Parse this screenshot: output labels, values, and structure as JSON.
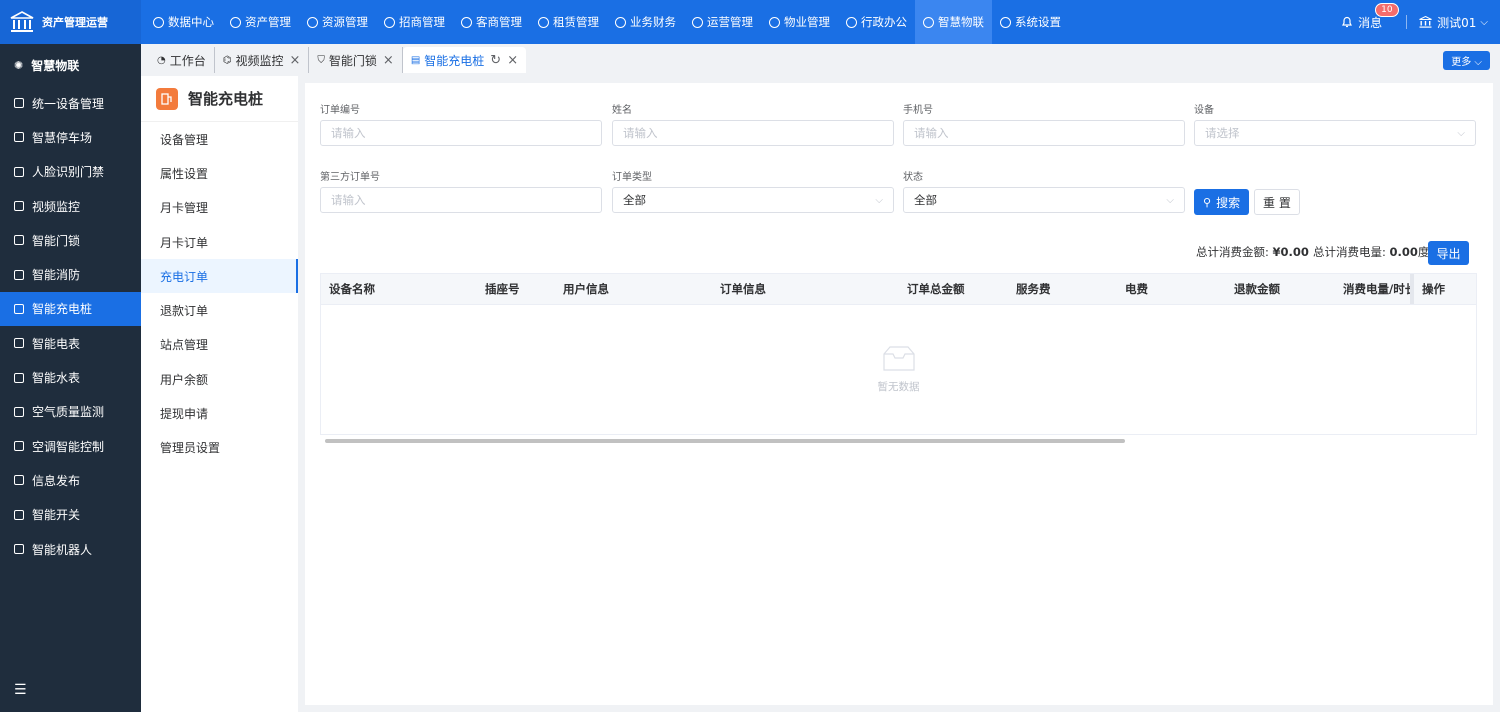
{
  "app": {
    "title": "资产管理运营"
  },
  "topnav": [
    {
      "label": "数据中心",
      "icon": "clock-icon"
    },
    {
      "label": "资产管理",
      "icon": "cube-icon"
    },
    {
      "label": "资源管理",
      "icon": "building-icon"
    },
    {
      "label": "招商管理",
      "icon": "tag-icon"
    },
    {
      "label": "客商管理",
      "icon": "users-icon"
    },
    {
      "label": "租赁管理",
      "icon": "house-icon"
    },
    {
      "label": "业务财务",
      "icon": "coin-icon"
    },
    {
      "label": "运营管理",
      "icon": "chart-icon"
    },
    {
      "label": "物业管理",
      "icon": "home-icon"
    },
    {
      "label": "行政办公",
      "icon": "monitor-icon"
    },
    {
      "label": "智慧物联",
      "icon": "atom-icon"
    },
    {
      "label": "系统设置",
      "icon": "gear-icon"
    }
  ],
  "header": {
    "messages_label": "消息",
    "messages_count": "10",
    "user_label": "测试01"
  },
  "sidebar": {
    "title": "智慧物联",
    "items": [
      {
        "label": "统一设备管理"
      },
      {
        "label": "智慧停车场"
      },
      {
        "label": "人脸识别门禁"
      },
      {
        "label": "视频监控"
      },
      {
        "label": "智能门锁"
      },
      {
        "label": "智能消防"
      },
      {
        "label": "智能充电桩"
      },
      {
        "label": "智能电表"
      },
      {
        "label": "智能水表"
      },
      {
        "label": "空气质量监测"
      },
      {
        "label": "空调智能控制"
      },
      {
        "label": "信息发布"
      },
      {
        "label": "智能开关"
      },
      {
        "label": "智能机器人"
      }
    ]
  },
  "tabs": [
    {
      "label": "工作台"
    },
    {
      "label": "视频监控"
    },
    {
      "label": "智能门锁"
    },
    {
      "label": "智能充电桩"
    }
  ],
  "more_label": "更多",
  "submenu": {
    "title": "智能充电桩",
    "items": [
      {
        "label": "设备管理"
      },
      {
        "label": "属性设置"
      },
      {
        "label": "月卡管理"
      },
      {
        "label": "月卡订单"
      },
      {
        "label": "充电订单"
      },
      {
        "label": "退款订单"
      },
      {
        "label": "站点管理"
      },
      {
        "label": "用户余额"
      },
      {
        "label": "提现申请"
      },
      {
        "label": "管理员设置"
      }
    ]
  },
  "filters": {
    "order_no": {
      "label": "订单编号",
      "placeholder": "请输入"
    },
    "name": {
      "label": "姓名",
      "placeholder": "请输入"
    },
    "phone": {
      "label": "手机号",
      "placeholder": "请输入"
    },
    "device": {
      "label": "设备",
      "placeholder": "请选择"
    },
    "third_order": {
      "label": "第三方订单号",
      "placeholder": "请输入"
    },
    "order_type": {
      "label": "订单类型",
      "value": "全部"
    },
    "status": {
      "label": "状态",
      "value": "全部"
    },
    "search_label": "搜索",
    "reset_label": "重 置"
  },
  "totals": {
    "amount_label": "总计消费金额:",
    "amount_value": "¥0.00",
    "energy_label": "总计消费电量:",
    "energy_value": "0.00",
    "energy_unit": "度"
  },
  "export_label": "导出",
  "table": {
    "columns": [
      "设备名称",
      "插座号",
      "用户信息",
      "订单信息",
      "订单总金额",
      "服务费",
      "电费",
      "退款金额",
      "消费电量/时长",
      "操作"
    ],
    "empty_text": "暂无数据"
  }
}
